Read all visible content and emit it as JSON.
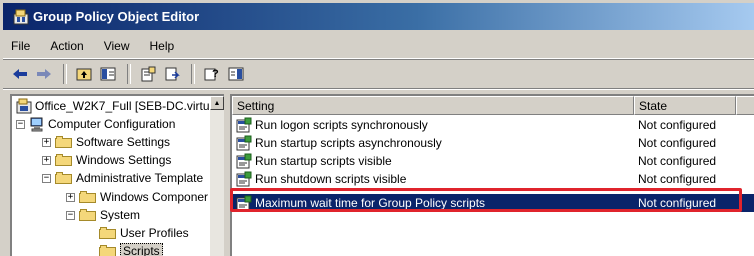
{
  "window": {
    "title": "Group Policy Object Editor",
    "title_icon": "gpedit-icon"
  },
  "menu": [
    {
      "label": "File"
    },
    {
      "label": "Action"
    },
    {
      "label": "View"
    },
    {
      "label": "Help"
    }
  ],
  "toolbar": {
    "buttons": [
      "back-icon",
      "forward-icon",
      "up-folder-icon",
      "show-hide-tree-icon",
      "properties-icon",
      "export-list-icon",
      "help-icon",
      "console-tree-icon"
    ]
  },
  "tree": {
    "root": "Office_W2K7_Full [SEB-DC.virtu",
    "computer_config": "Computer Configuration",
    "software_settings": "Software Settings",
    "windows_settings": "Windows Settings",
    "admin_templates": "Administrative Template",
    "windows_components": "Windows Componer",
    "system": "System",
    "user_profiles": "User Profiles",
    "scripts": "Scripts"
  },
  "list": {
    "columns": {
      "setting": "Setting",
      "state": "State"
    },
    "rows": [
      {
        "setting": "Run logon scripts synchronously",
        "state": "Not configured"
      },
      {
        "setting": "Run startup scripts asynchronously",
        "state": "Not configured"
      },
      {
        "setting": "Run startup scripts visible",
        "state": "Not configured"
      },
      {
        "setting": "Run shutdown scripts visible",
        "state": "Not configured"
      },
      {
        "setting": "Maximum wait time for Group Policy scripts",
        "state": "Not configured"
      }
    ],
    "selected_index": 4
  },
  "colors": {
    "title_gradient_start": "#0a246a",
    "selection": "#0a246a",
    "highlight_box": "#e0242c",
    "window_face": "#d4d0c8"
  }
}
